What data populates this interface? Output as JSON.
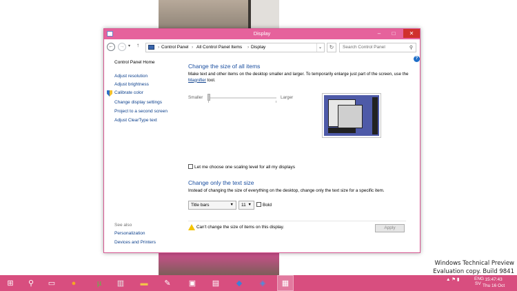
{
  "window": {
    "title": "Display"
  },
  "address": {
    "crumbs": [
      "Control Panel",
      "All Control Panel Items",
      "Display"
    ],
    "search_placeholder": "Search Control Panel"
  },
  "sidebar": {
    "home": "Control Panel Home",
    "links": [
      "Adjust resolution",
      "Adjust brightness",
      "Calibrate color",
      "Change display settings",
      "Project to a second screen",
      "Adjust ClearType text"
    ],
    "see_also_label": "See also",
    "see_also": [
      "Personalization",
      "Devices and Printers"
    ]
  },
  "main": {
    "heading": "Change the size of all items",
    "desc_pre": "Make text and other items on the desktop smaller and larger. To temporarily enlarge just part of the screen, use the ",
    "desc_link": "Magnifier",
    "desc_post": " tool.",
    "slider_min_label": "Smaller",
    "slider_max_label": "Larger",
    "slider_level": 0,
    "scaling_checkbox": "Let me choose one scaling level for all my displays",
    "text_heading": "Change only the text size",
    "text_desc": "Instead of changing the size of everything on the desktop, change only the text size for a specific item.",
    "item_select": "Title bars",
    "size_select": "11",
    "bold_label": "Bold",
    "warning": "Can't change the size of items on this display.",
    "apply": "Apply"
  },
  "watermark": {
    "line1": "Windows Technical Preview",
    "line2": "Evaluation copy. Build 9841"
  },
  "taskbar": {
    "language": "ENG",
    "language2": "SV",
    "time": "15:47:43",
    "date": "Thu 16 Oct",
    "colors": {
      "taskbar": "#d84e7f",
      "titlebar": "#e6629c",
      "link": "#0b3f8c",
      "heading": "#1b4fa0"
    }
  }
}
